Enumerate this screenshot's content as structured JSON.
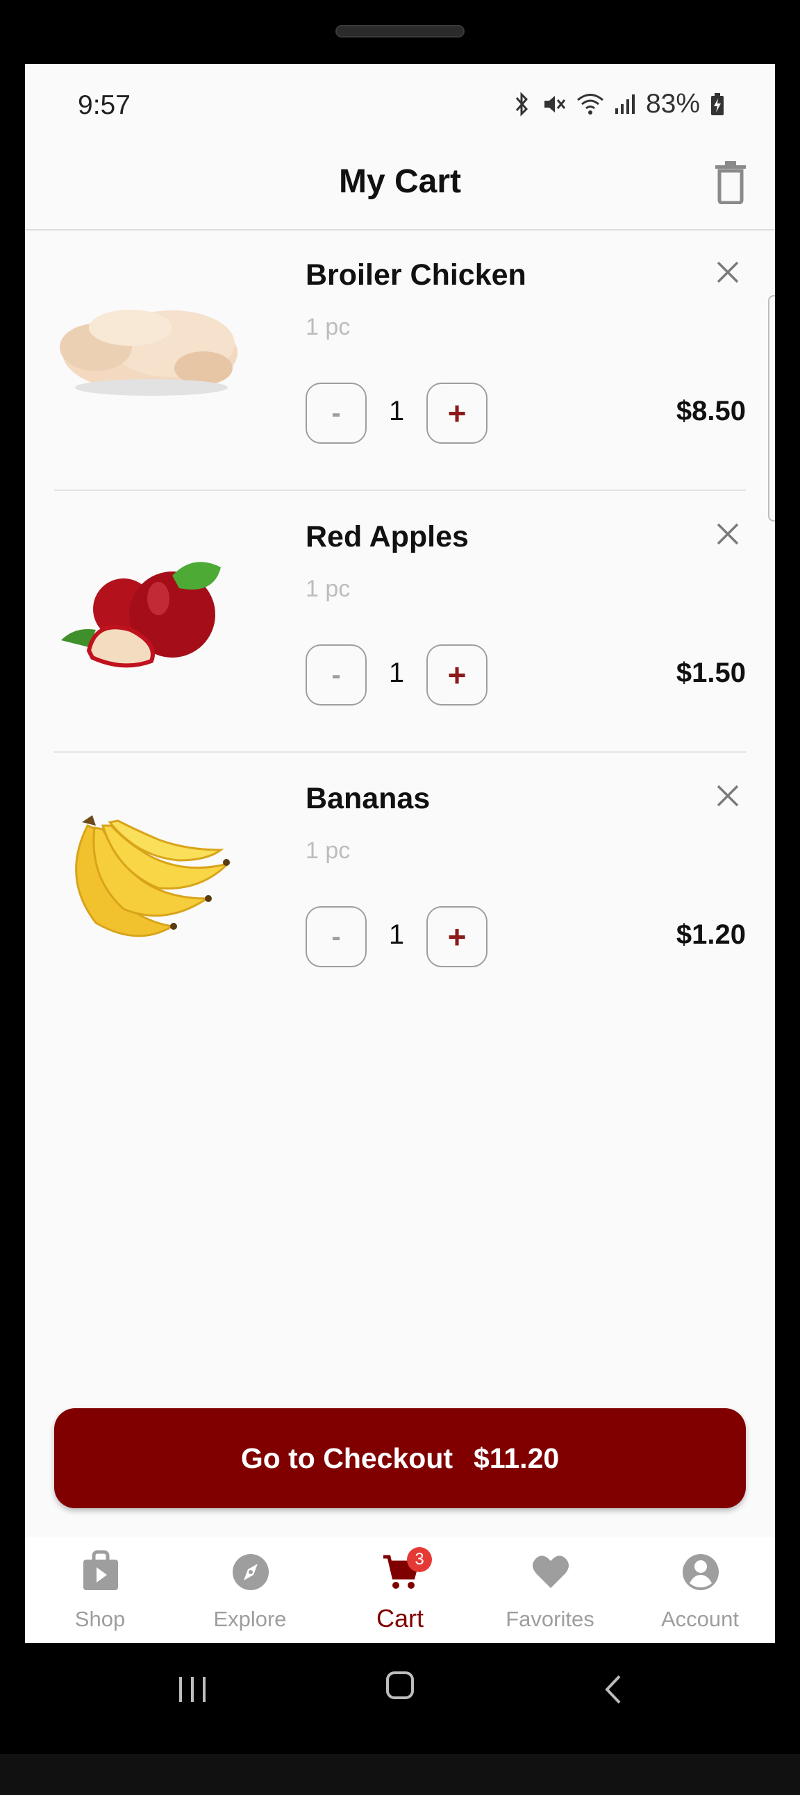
{
  "status": {
    "time": "9:57",
    "battery": "83%"
  },
  "header": {
    "title": "My Cart"
  },
  "cart": {
    "items": [
      {
        "name": "Broiler Chicken",
        "unit": "1 pc",
        "quantity": "1",
        "price": "$8.50",
        "image": "chicken"
      },
      {
        "name": "Red Apples",
        "unit": "1 pc",
        "quantity": "1",
        "price": "$1.50",
        "image": "apples"
      },
      {
        "name": "Bananas",
        "unit": "1 pc",
        "quantity": "1",
        "price": "$1.20",
        "image": "bananas"
      }
    ],
    "minus_label": "-",
    "plus_label": "+"
  },
  "checkout": {
    "label": "Go to Checkout",
    "total": "$11.20"
  },
  "nav": {
    "items": [
      {
        "label": "Shop",
        "icon": "shop-bag-icon"
      },
      {
        "label": "Explore",
        "icon": "compass-icon"
      },
      {
        "label": "Cart",
        "icon": "cart-icon",
        "badge": "3",
        "active": true
      },
      {
        "label": "Favorites",
        "icon": "heart-icon"
      },
      {
        "label": "Account",
        "icon": "account-icon"
      }
    ]
  },
  "colors": {
    "accent": "#800000",
    "plus": "#8b1a1a",
    "badge": "#e53935",
    "muted": "#9e9e9e"
  }
}
